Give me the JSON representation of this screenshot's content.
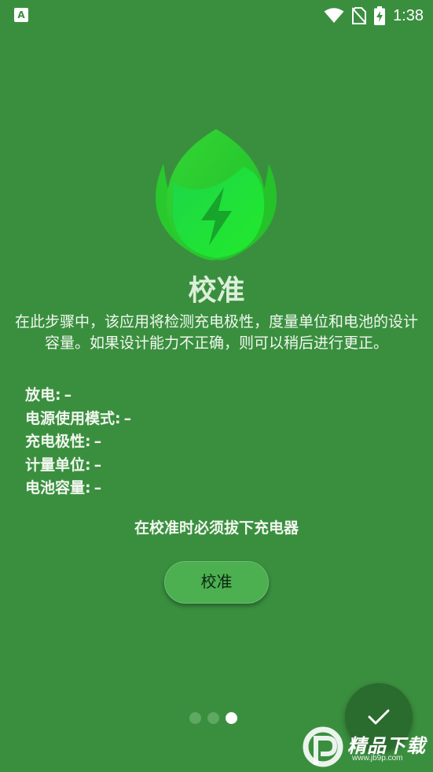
{
  "status_bar": {
    "left_icon": "A",
    "time": "1:38",
    "icons": [
      "wifi-icon",
      "no-sim-icon",
      "battery-charging-icon"
    ]
  },
  "logo": {
    "icon": "leaf-lightning-logo",
    "colors": {
      "outer_leaf": "#2ec92e",
      "inner_leaf": "#1fe43a",
      "bolt": "#1a9a2a"
    }
  },
  "main": {
    "title": "校准",
    "description": "在此步骤中，该应用将检测充电极性，度量单位和电池的设计容量。如果设计能力不正确，则可以稍后进行更正。",
    "info": [
      {
        "label": "放电:",
        "value": "–"
      },
      {
        "label": "电源使用模式:",
        "value": "–"
      },
      {
        "label": "充电极性:",
        "value": "–"
      },
      {
        "label": "计量单位:",
        "value": "–"
      },
      {
        "label": "电池容量:",
        "value": "–"
      }
    ],
    "notice": "在校准时必须拔下充电器",
    "calibrate_label": "校准"
  },
  "pager": {
    "count": 3,
    "active_index": 2
  },
  "fab": {
    "icon": "check-icon"
  },
  "watermark": {
    "text": "精品下载",
    "sub": "www.jb9p.com"
  },
  "colors": {
    "background": "#3a8f3f",
    "button": "#4caf50",
    "fab": "#2a6b2e"
  }
}
